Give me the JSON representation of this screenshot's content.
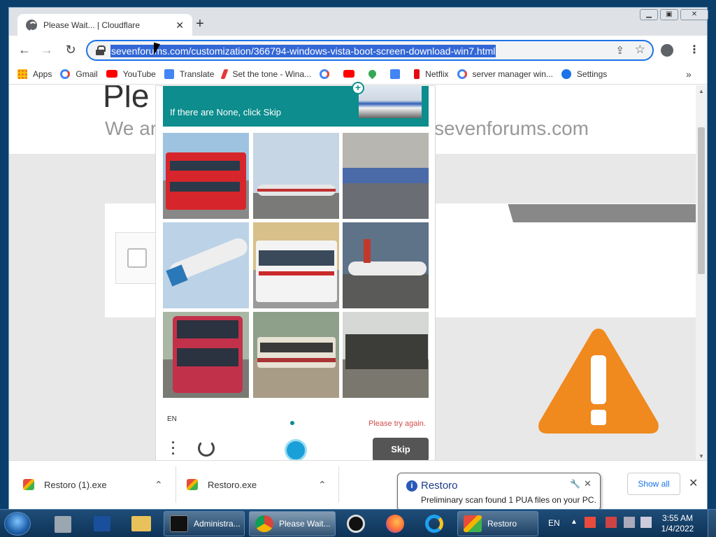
{
  "browser": {
    "tab_title": "Please Wait... | Cloudflare",
    "tab_close": "✕",
    "new_tab": "+",
    "url": "sevenforums.com/customization/366794-windows-vista-boot-screen-download-win7.html",
    "bookmarks": [
      "Apps",
      "Gmail",
      "YouTube",
      "Translate",
      "Set the tone - Wina...",
      "",
      "",
      "",
      "",
      "Netflix",
      "server manager win...",
      "Settings"
    ],
    "bookmarks_more": "»"
  },
  "page": {
    "heading_fragment": "Ple",
    "sub_left": "We ar",
    "sub_right": "sevenforums.com"
  },
  "captcha": {
    "instruction": "If there are None, click Skip",
    "lang": "EN",
    "error": "Please try again.",
    "skip_label": "Skip",
    "images": [
      "red-double-decker-bus",
      "airliner-on-runway",
      "trains-in-yard",
      "airplane-in-flight",
      "white-red-city-bus",
      "airliner-on-tarmac",
      "red-double-decker-bus",
      "city-bus",
      "freight-train"
    ]
  },
  "downloads": {
    "items": [
      {
        "name": "Restoro (1).exe"
      },
      {
        "name": "Restoro.exe"
      }
    ],
    "show_all": "Show all"
  },
  "notification": {
    "title": "Restoro",
    "message": "Preliminary scan found 1 PUA files on your PC."
  },
  "taskbar": {
    "windows": [
      {
        "label": "Administra..."
      },
      {
        "label": "Please Wait..."
      },
      {
        "label": "Restoro"
      }
    ],
    "lang": "EN",
    "time": "3:55 AM",
    "date": "1/4/2022"
  },
  "colors": {
    "captcha_accent": "#0d8d8d",
    "warning": "#f0891e",
    "error": "#d24b4b"
  }
}
